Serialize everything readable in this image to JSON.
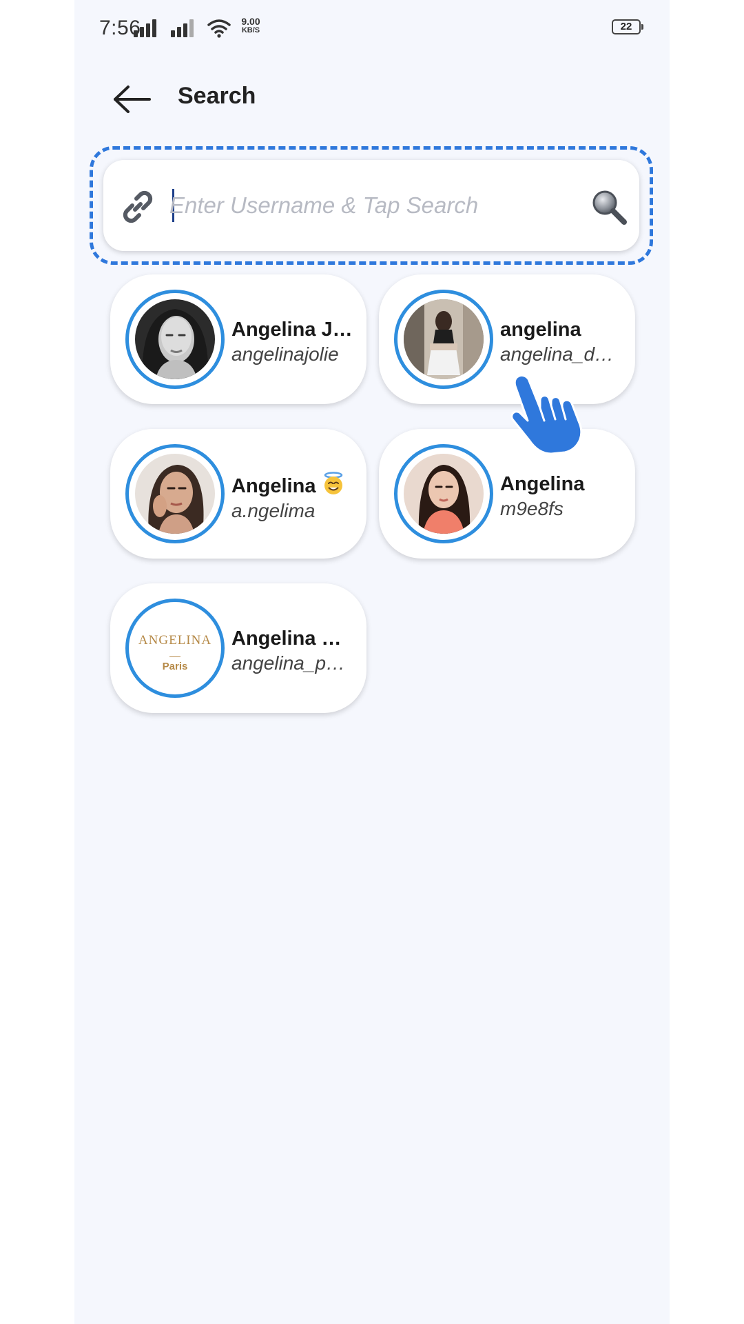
{
  "status_bar": {
    "time": "7:56",
    "net_speed_value": "9.00",
    "net_speed_unit": "KB/S",
    "battery": "22",
    "icons": [
      "signal-icon",
      "signal-icon",
      "wifi-icon",
      "battery-icon"
    ]
  },
  "header": {
    "title": "Search",
    "back_icon": "arrow-left-icon"
  },
  "search": {
    "placeholder": "Enter Username & Tap Search",
    "value": "",
    "leading_icon": "link-icon",
    "trailing_icon": "search-icon"
  },
  "results": [
    {
      "name": "Angelina J…",
      "handle": "angelinajolie"
    },
    {
      "name": "angelina",
      "handle": "angelina_d…"
    },
    {
      "name": "Angelina",
      "name_emoji": "smiling-face-with-halo",
      "handle": "a.ngelima"
    },
    {
      "name": "Angelina",
      "handle": "m9e8fs"
    },
    {
      "name": "Angelina …",
      "handle": "angelina_p…",
      "logo_text": "ANGELINA",
      "logo_subtext": "Paris"
    }
  ],
  "colors": {
    "accent": "#2f78dc",
    "ring": "#2e8ede",
    "background": "#f5f7fd"
  }
}
